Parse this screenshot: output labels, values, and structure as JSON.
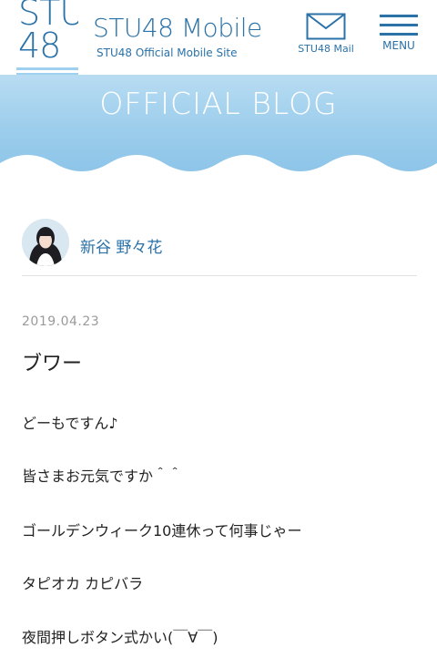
{
  "header": {
    "logo_line1": "STU",
    "logo_line2": "48",
    "brand_title": "STU48 Mobile",
    "brand_subtitle": "STU48 Official Mobile Site",
    "mail_label": "STU48 Mail",
    "menu_label": "MENU",
    "accent_color": "#2a72a8"
  },
  "banner": {
    "title": "OFFICIAL BLOG"
  },
  "author": {
    "name": "新谷 野々花"
  },
  "post": {
    "date": "2019.04.23",
    "title": "ブワー",
    "lines": [
      "どーもですん♪",
      "皆さまお元気ですか＾＾",
      "ゴールデンウィーク10連休って何事じゃー",
      "タピオカ カピバラ",
      "夜間押しボタン式かい(￣∀￣)"
    ]
  }
}
